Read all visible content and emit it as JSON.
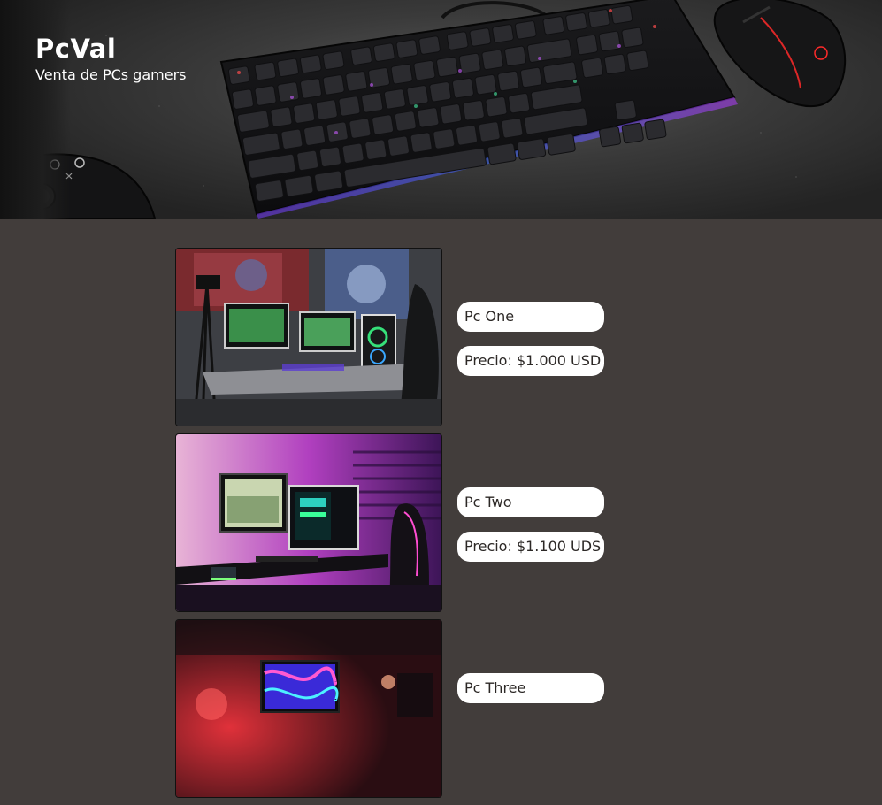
{
  "header": {
    "title": "PcVal",
    "subtitle": "Venta de PCs gamers"
  },
  "products": [
    {
      "name": "Pc One",
      "price": "Precio: $1.000 USD",
      "photo": "gaming-setup-photo-1"
    },
    {
      "name": "Pc Two",
      "price": "Precio: $1.100 UDS",
      "photo": "gaming-setup-photo-2"
    },
    {
      "name": "Pc Three",
      "price": "",
      "photo": "gaming-setup-photo-3"
    }
  ],
  "colors": {
    "page_background": "#423d3b",
    "pill_background": "#ffffff",
    "pill_text": "#2c2826",
    "title_text": "#ffffff"
  },
  "icons": [
    "gamepad-icon",
    "keyboard-icon",
    "mouse-icon"
  ]
}
